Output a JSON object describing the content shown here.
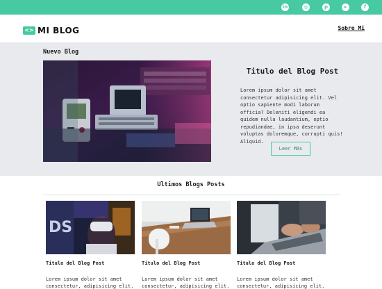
{
  "social": [
    {
      "icon": "linkedin-icon",
      "glyph": "in"
    },
    {
      "icon": "instagram-icon",
      "glyph": "◎"
    },
    {
      "icon": "pinterest-icon",
      "glyph": "p"
    },
    {
      "icon": "youtube-icon",
      "glyph": "▸"
    },
    {
      "icon": "facebook-icon",
      "glyph": "f"
    }
  ],
  "header": {
    "logo_text": "MI BLOG",
    "logo_mark": "<>",
    "nav_link": "Sobre Mi"
  },
  "hero": {
    "section_title": "Nuevo Blog",
    "post_title": "Titulo del Blog Post",
    "excerpt": "Lorem ipsum dolor sit amet consectetur adipisicing elit. Vel optio sapiente modi laborum officia? Deleniti eligendi ea quidem nulla laudantium, optio repudiandae, in ipsa deserunt voluptas doloremque, corrupti quis! Aliquid.",
    "button": "Leer Más"
  },
  "latest": {
    "title": "Ultimos Blogs Posts",
    "cards": [
      {
        "title": "Titulo del Blog Post",
        "excerpt": "Lorem ipsum dolor sit amet consectetur, adipisicing elit."
      },
      {
        "title": "Titulo del Blog Post",
        "excerpt": "Lorem ipsum dolor sit amet consectetur, adipisicing elit."
      },
      {
        "title": "Titulo del Blog Post",
        "excerpt": "Lorem ipsum dolor sit amet consectetur, adipisicing elit."
      }
    ]
  },
  "colors": {
    "accent": "#47c9a2",
    "hero_bg": "#e8eaed"
  }
}
